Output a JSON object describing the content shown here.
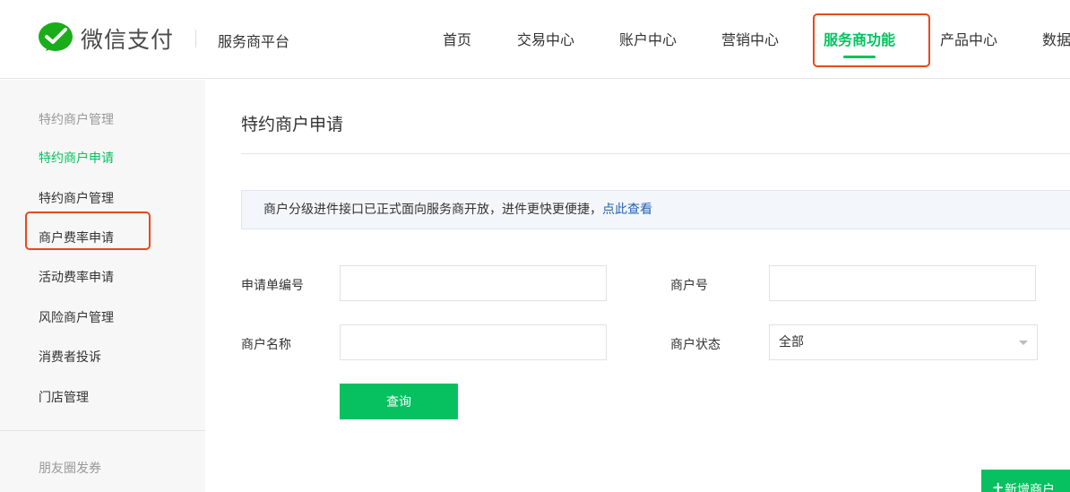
{
  "header": {
    "brand": "微信支付",
    "platform": "服务商平台",
    "nav": [
      {
        "label": "首页"
      },
      {
        "label": "交易中心"
      },
      {
        "label": "账户中心"
      },
      {
        "label": "营销中心"
      },
      {
        "label": "服务商功能",
        "active": true
      },
      {
        "label": "产品中心"
      },
      {
        "label": "数据"
      }
    ]
  },
  "sidebar": {
    "group1": "特约商户管理",
    "items": [
      {
        "label": "特约商户申请",
        "active": true
      },
      {
        "label": "特约商户管理"
      },
      {
        "label": "商户费率申请"
      },
      {
        "label": "活动费率申请"
      },
      {
        "label": "风险商户管理"
      },
      {
        "label": "消费者投诉"
      },
      {
        "label": "门店管理"
      }
    ],
    "group2": "朋友圈发券"
  },
  "main": {
    "title": "特约商户申请",
    "notice": {
      "text": "商户分级进件接口已正式面向服务商开放，进件更快更便捷，",
      "link": "点此查看"
    },
    "form": {
      "apply_no_label": "申请单编号",
      "apply_no_value": "",
      "merchant_no_label": "商户号",
      "merchant_no_value": "",
      "merchant_name_label": "商户名称",
      "merchant_name_value": "",
      "status_label": "商户状态",
      "status_value": "全部",
      "query_label": "查询"
    },
    "add_button": "新增商户"
  },
  "colors": {
    "accent": "#07c160",
    "highlight": "#e8481f",
    "link": "#2660b4"
  }
}
